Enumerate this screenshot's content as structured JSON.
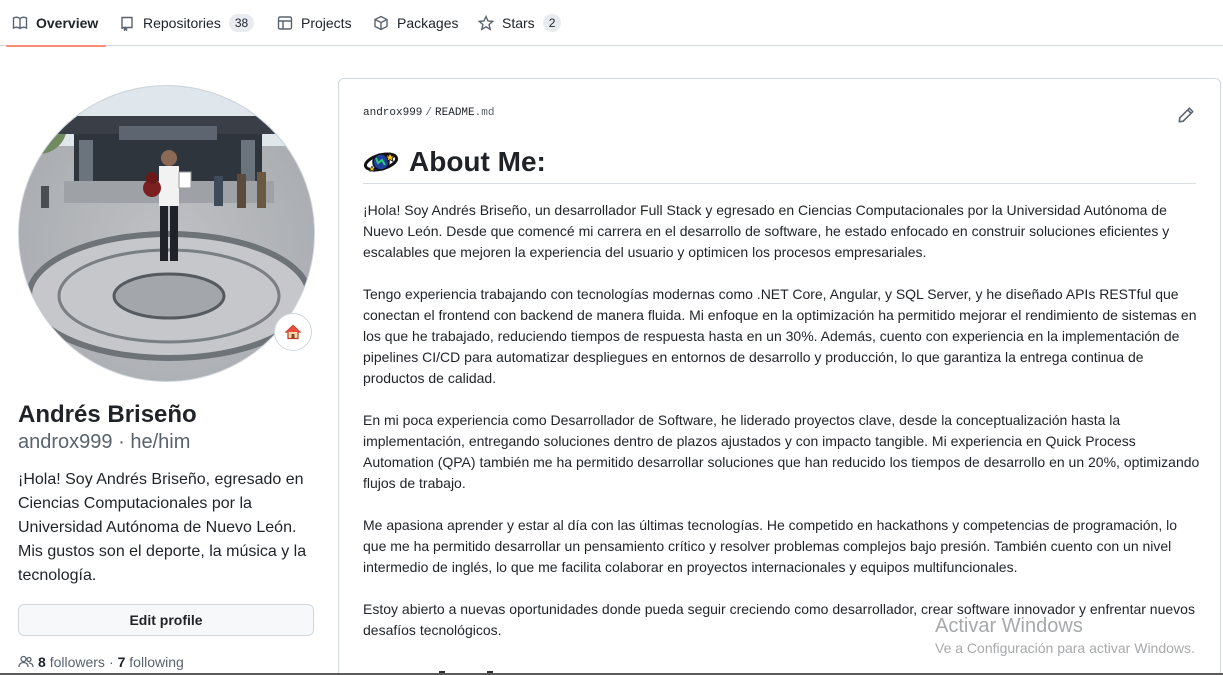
{
  "nav": {
    "tabs": [
      {
        "label": "Overview",
        "icon": "book-icon"
      },
      {
        "label": "Repositories",
        "icon": "repo-icon",
        "count": "38"
      },
      {
        "label": "Projects",
        "icon": "table-icon"
      },
      {
        "label": "Packages",
        "icon": "package-icon"
      },
      {
        "label": "Stars",
        "icon": "star-icon",
        "count": "2"
      }
    ],
    "active_tab": "Overview",
    "active_color": "#fd8c73"
  },
  "profile": {
    "fullname": "Andrés Briseño",
    "username": "androx999",
    "pronouns": "he/him",
    "separator": "·",
    "bio": "¡Hola! Soy Andrés Briseño, egresado en Ciencias Computacionales por la Universidad Autónoma de Nuevo León. Mis gustos son el deporte, la música y la tecnología.",
    "edit_label": "Edit profile",
    "followers_count": "8",
    "followers_label": "followers",
    "following_count": "7",
    "following_label": "following",
    "status_icon": "house-emoji-icon"
  },
  "readme": {
    "owner": "androx999",
    "file_name": "README",
    "file_ext": ".md",
    "heading": "About Me:",
    "heading_icon": "planet-emoji-icon",
    "paragraphs": [
      "¡Hola! Soy Andrés Briseño, un desarrollador Full Stack y egresado en Ciencias Computacionales por la Universidad Autónoma de Nuevo León. Desde que comencé mi carrera en el desarrollo de software, he estado enfocado en construir soluciones eficientes y escalables que mejoren la experiencia del usuario y optimicen los procesos empresariales.",
      "Tengo experiencia trabajando con tecnologías modernas como .NET Core, Angular, y SQL Server, y he diseñado APIs RESTful que conectan el frontend con backend de manera fluida. Mi enfoque en la optimización ha permitido mejorar el rendimiento de sistemas en los que he trabajado, reduciendo tiempos de respuesta hasta en un 30%. Además, cuento con experiencia en la implementación de pipelines CI/CD para automatizar despliegues en entornos de desarrollo y producción, lo que garantiza la entrega continua de productos de calidad.",
      "En mi poca experiencia como Desarrollador de Software, he liderado proyectos clave, desde la conceptualización hasta la implementación, entregando soluciones dentro de plazos ajustados y con impacto tangible. Mi experiencia en Quick Process Automation (QPA) también me ha permitido desarrollar soluciones que han reducido los tiempos de desarrollo en un 20%, optimizando flujos de trabajo.",
      "Me apasiona aprender y estar al día con las últimas tecnologías. He competido en hackathons y competencias de programación, lo que me ha permitido desarrollar un pensamiento crítico y resolver problemas complejos bajo presión. También cuento con un nivel intermedio de inglés, lo que me facilita colaborar en proyectos internacionales y equipos multifuncionales.",
      "Estoy abierto a nuevas oportunidades donde pueda seguir creciendo como desarrollador, crear software innovador y enfrentar nuevos desafíos tecnológicos."
    ]
  },
  "watermark": {
    "line1": "Activar Windows",
    "line2": "Ve a Configuración para activar Windows."
  }
}
